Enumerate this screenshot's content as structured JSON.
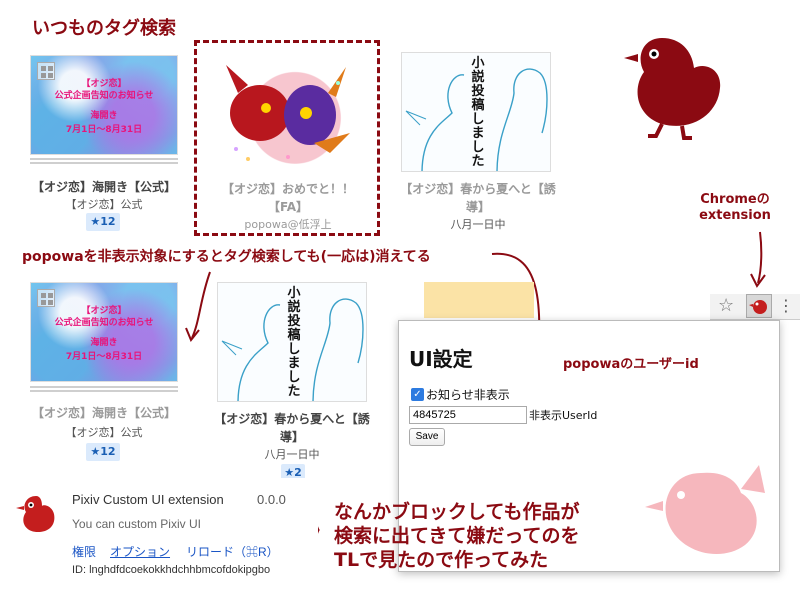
{
  "heading": "いつものタグ検索",
  "row1": {
    "cards": [
      {
        "title": "【オジ恋】海開き【公式】",
        "meta": "【オジ恋】公式",
        "stars": "★12",
        "thumb_lines": [
          "【オジ恋】",
          "公式企画告知のお知らせ",
          "海開き",
          "7月1日〜8月31日"
        ]
      },
      {
        "title": "【オジ恋】おめでと！！【FA】",
        "meta": "popowa@低浮上"
      },
      {
        "title": "【オジ恋】春から夏へと【誘導】",
        "meta": "八月一日中",
        "sketch_text": "小説投稿しました"
      }
    ]
  },
  "annotation_hide": "popowaを非表示対象にするとタグ検索しても(一応は)消えてる",
  "row2": {
    "cards": [
      {
        "title": "【オジ恋】海開き【公式】",
        "meta": "【オジ恋】公式",
        "stars": "★12",
        "thumb_lines": [
          "【オジ恋】",
          "公式企画告知のお知らせ",
          "海開き",
          "7月1日〜8月31日"
        ]
      },
      {
        "title": "【オジ恋】春から夏へと【誘導】",
        "meta": "八月一日中",
        "stars": "★2",
        "sketch_text": "小説投稿しました"
      }
    ]
  },
  "chrome_annot": {
    "line1": "Chromeの",
    "line2": "extension"
  },
  "popup": {
    "title": "UI設定",
    "checkbox_label": "お知らせ非表示",
    "checkbox_mark": "✓",
    "userid_value": "4845725",
    "userid_label": "非表示UserId",
    "save_label": "Save",
    "annot": "popowaのユーザーid"
  },
  "extension": {
    "name": "Pixiv Custom UI extension",
    "version": "0.0.0",
    "description": "You can custom Pixiv UI",
    "links": [
      "権限",
      "オプション",
      "リロード（⌘R）"
    ],
    "id_line": "ID: lnghdfdcoekokkhdchhbmcofdokipgbo"
  },
  "bottom_annot": {
    "line1": "なんかブロックしても作品が",
    "line2": "検索に出てきて嫌だってのを",
    "line3": "TLで見たので作ってみた"
  },
  "icons": [
    "bird-icon",
    "star-icon",
    "extension-icon",
    "checkbox-icon",
    "multi-page-icon"
  ],
  "colors": {
    "accent": "#8b0a12",
    "link": "#1a55c5",
    "badge_bg": "#dbeafc",
    "checkbox": "#2d7be0"
  }
}
